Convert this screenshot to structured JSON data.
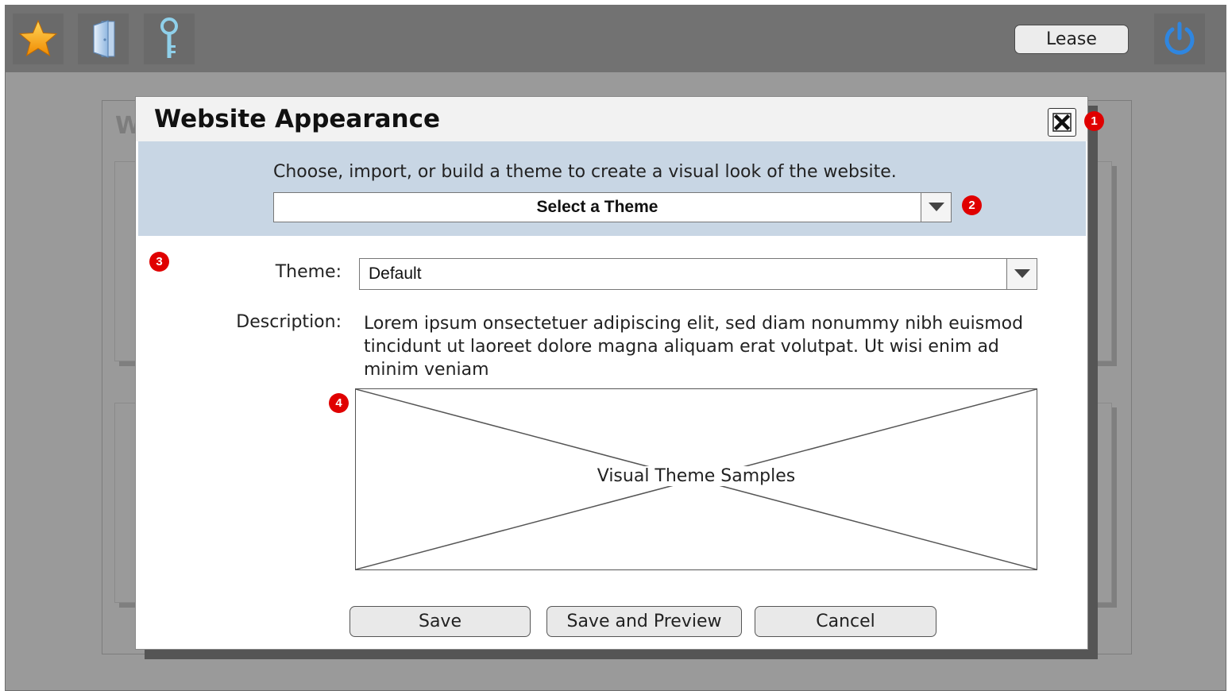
{
  "toolbar": {
    "icons": [
      "star-icon",
      "door-icon",
      "key-icon",
      "power-icon"
    ],
    "lease_label": "Lease"
  },
  "background": {
    "heading_partial": "W"
  },
  "dialog": {
    "title": "Website Appearance",
    "close_icon": "close-icon",
    "banner_text": "Choose, import, or build a theme to create a visual look of the website.",
    "theme_picker": {
      "value": "Select a Theme"
    },
    "theme_label": "Theme:",
    "theme_value": "Default",
    "description_label": "Description:",
    "description_text": "Lorem ipsum onsectetuer adipiscing elit, sed diam nonummy nibh euismod tincidunt ut laoreet dolore magna aliquam erat volutpat. Ut wisi enim ad minim veniam",
    "preview_label": "Visual Theme Samples",
    "buttons": {
      "save": "Save",
      "save_preview": "Save and Preview",
      "cancel": "Cancel"
    }
  },
  "annotations": [
    "1",
    "2",
    "3",
    "4"
  ],
  "colors": {
    "topbar": "#727272",
    "background": "#9a9a9a",
    "banner": "#c8d6e4",
    "badge": "#e00000",
    "star": "#f7a21b",
    "power": "#3a8fe0"
  }
}
